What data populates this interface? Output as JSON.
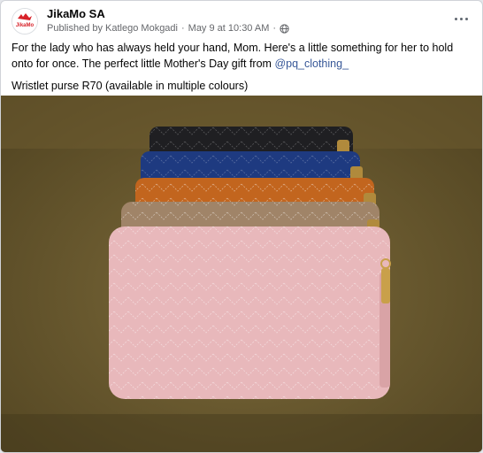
{
  "post": {
    "page_name": "JikaMo SA",
    "avatar_text": "JikaMo",
    "published_by": "Published by Katlego Mokgadi",
    "timestamp": "May 9 at 10:30 AM",
    "separator": "·",
    "caption_part1": "For the lady who has always held your hand, Mom. Here's a little something for her to hold onto for once. The perfect little Mother's Day gift from ",
    "mention": "@pq_clothing_",
    "caption_line2": "Wristlet purse R70 (available in multiple colours)",
    "icons": {
      "privacy": "globe-icon",
      "menu": "more-options-icon"
    }
  },
  "photo": {
    "subject": "wristlet purses stacked",
    "colors": [
      "#1f1f22",
      "#1e3a80",
      "#c2651e",
      "#a08468",
      "#e8b8bb"
    ]
  }
}
